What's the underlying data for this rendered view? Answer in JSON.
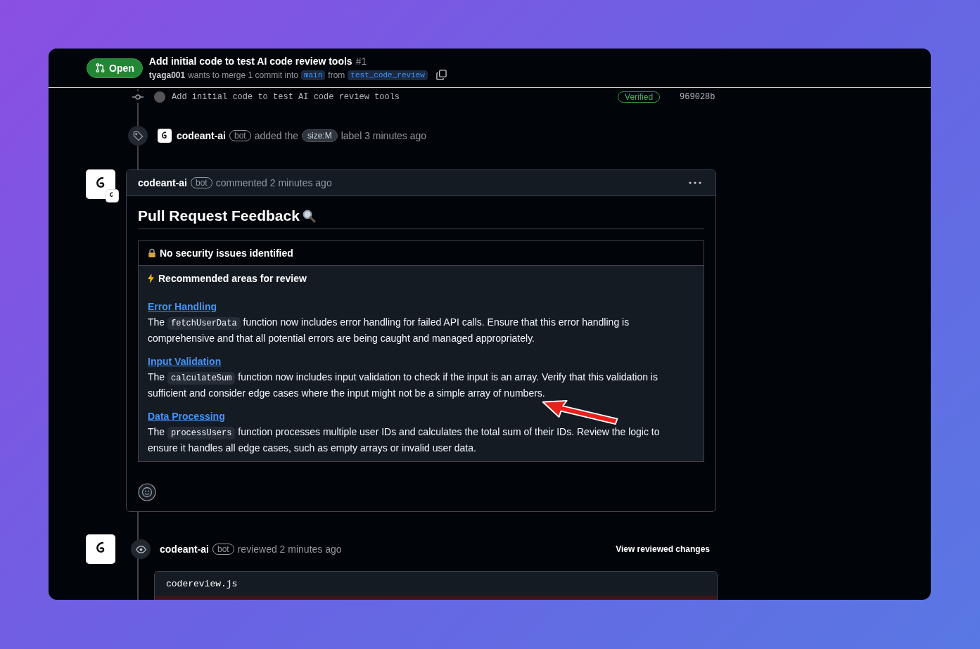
{
  "pull_request": {
    "status": "Open",
    "title": "Add initial code to test AI code review tools",
    "number": "#1",
    "author": "tyaga001",
    "merge_text": "wants to merge 1 commit into",
    "base_branch": "main",
    "from_text": "from",
    "head_branch": "test_code_review"
  },
  "commit": {
    "message": "Add initial code to test AI code review tools",
    "verified": "Verified",
    "sha": "969028b"
  },
  "label_event": {
    "author": "codeant-ai",
    "badge": "bot",
    "action": "added the",
    "label": "size:M",
    "suffix": "label 3 minutes ago"
  },
  "comment": {
    "author": "codeant-ai",
    "badge": "bot",
    "action": "commented 2 minutes ago",
    "heading": "Pull Request Feedback",
    "security": "No security issues identified",
    "recommended": "Recommended areas for review",
    "areas": [
      {
        "title": "Error Handling",
        "before": "The",
        "code": "fetchUserData",
        "after": "function now includes error handling for failed API calls. Ensure that this error handling is comprehensive and that all potential errors are being caught and managed appropriately."
      },
      {
        "title": "Input Validation",
        "before": "The",
        "code": "calculateSum",
        "after": "function now includes input validation to check if the input is an array. Verify that this validation is sufficient and consider edge cases where the input might not be a simple array of numbers."
      },
      {
        "title": "Data Processing",
        "before": "The",
        "code": "processUsers",
        "after": "function processes multiple user IDs and calculates the total sum of their IDs. Review the logic to ensure it handles all edge cases, such as empty arrays or invalid user data."
      }
    ]
  },
  "review_event": {
    "author": "codeant-ai",
    "badge": "bot",
    "action": "reviewed 2 minutes ago",
    "link": "View reviewed changes"
  },
  "code_file": {
    "name": "codereview.js"
  }
}
